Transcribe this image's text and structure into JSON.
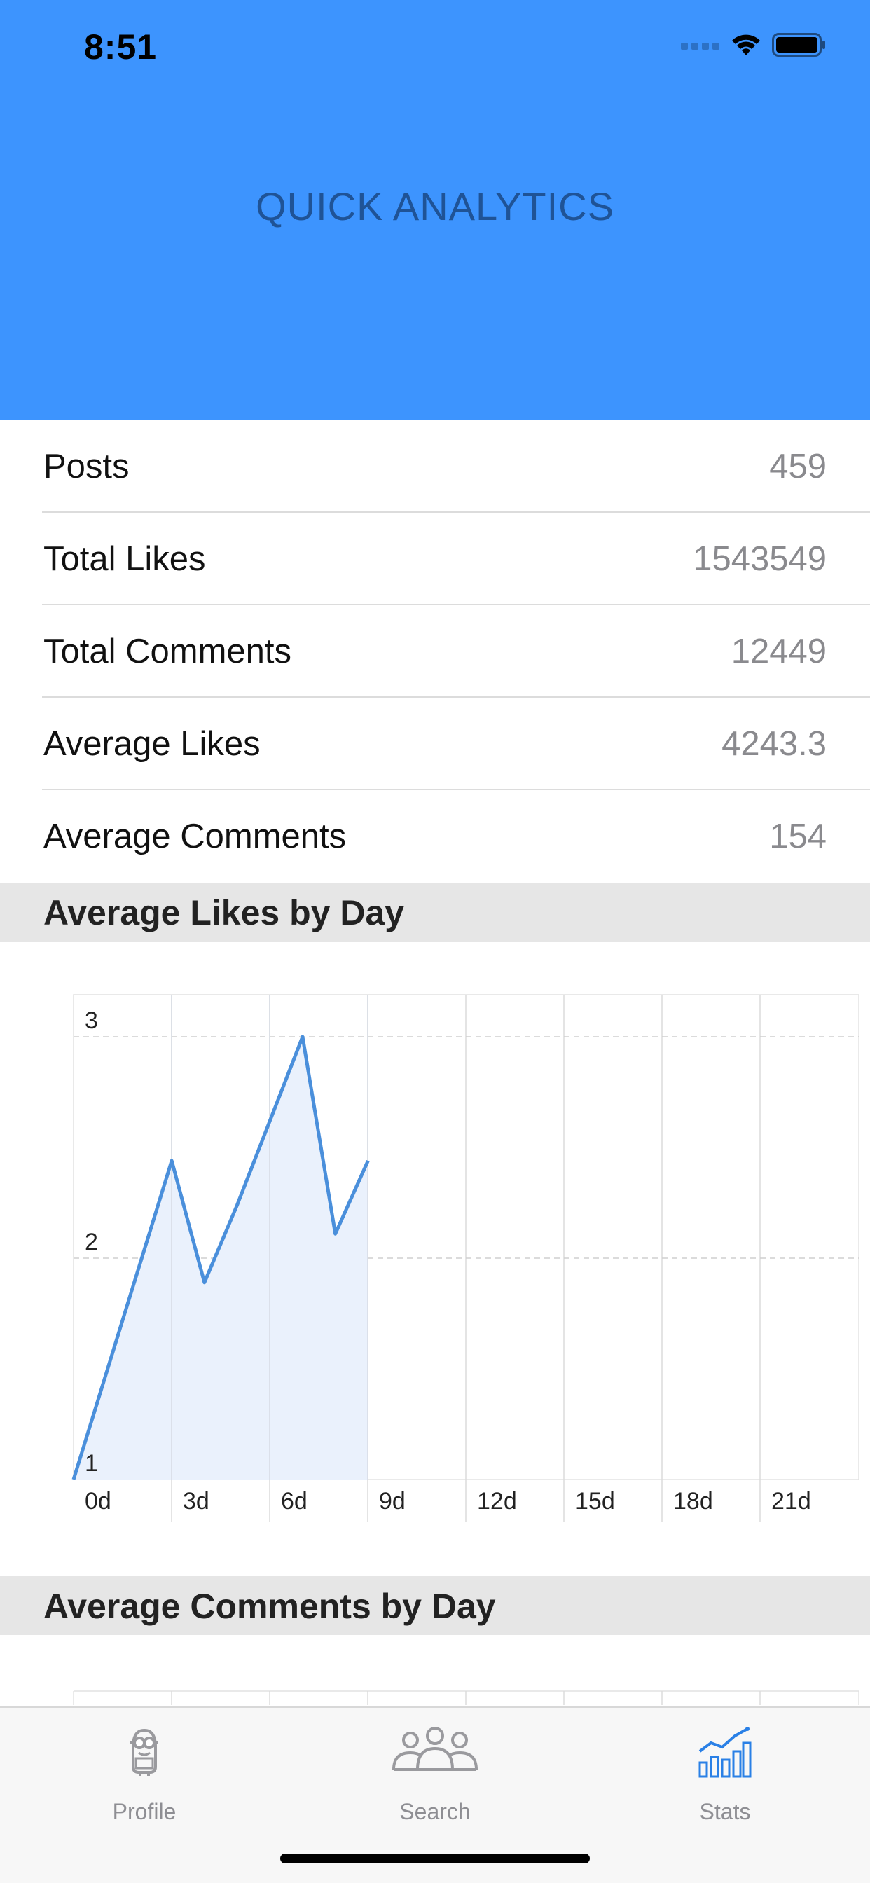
{
  "status_bar": {
    "time": "8:51"
  },
  "header": {
    "title": "QUICK ANALYTICS"
  },
  "stats": [
    {
      "label": "Posts",
      "value": "459"
    },
    {
      "label": "Total Likes",
      "value": "1543549"
    },
    {
      "label": "Total Comments",
      "value": "12449"
    },
    {
      "label": "Average Likes",
      "value": "4243.3"
    },
    {
      "label": "Average Comments",
      "value": "154"
    }
  ],
  "sections": {
    "likes_by_day": "Average Likes by Day",
    "comments_by_day": "Average Comments by Day"
  },
  "chart_data": [
    {
      "type": "area",
      "title": "Average Likes by Day",
      "x": [
        0,
        3,
        4,
        5,
        7,
        8,
        9
      ],
      "y": [
        1,
        2.44,
        1.89,
        2.24,
        3,
        2.11,
        2.44
      ],
      "xticks": [
        "0d",
        "3d",
        "6d",
        "9d",
        "12d",
        "15d",
        "18d",
        "21d"
      ],
      "yticks": [
        "1",
        "2",
        "3"
      ],
      "xlim": [
        0,
        24
      ],
      "ylim": [
        1,
        3.19
      ],
      "grid": true,
      "color": "#4a8fdb",
      "fill": "#eaf1fc"
    },
    {
      "type": "area",
      "title": "Average Comments by Day",
      "x": [],
      "y": []
    }
  ],
  "tabs": [
    {
      "label": "Profile",
      "icon": "minion-icon",
      "active": false
    },
    {
      "label": "Search",
      "icon": "people-icon",
      "active": false
    },
    {
      "label": "Stats",
      "icon": "bar-chart-icon",
      "active": true
    }
  ],
  "colors": {
    "header_bg": "#3d94fe",
    "header_title": "#1f5396",
    "accent": "#2a80e6",
    "section_bg": "#e6e6e6"
  }
}
